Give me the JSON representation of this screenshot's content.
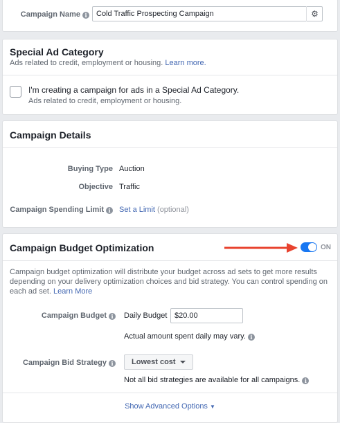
{
  "campaign_name": {
    "label": "Campaign Name",
    "value": "Cold Traffic Prospecting Campaign"
  },
  "special_ad_category": {
    "title": "Special Ad Category",
    "desc": "Ads related to credit, employment or housing.",
    "learn_more": "Learn more.",
    "checkbox_label": "I'm creating a campaign for ads in a Special Ad Category.",
    "checkbox_sub": "Ads related to credit, employment or housing."
  },
  "campaign_details": {
    "title": "Campaign Details",
    "buying_type_label": "Buying Type",
    "buying_type_value": "Auction",
    "objective_label": "Objective",
    "objective_value": "Traffic",
    "spending_limit_label": "Campaign Spending Limit",
    "set_limit_link": "Set a Limit",
    "optional": "(optional)"
  },
  "cbo": {
    "title": "Campaign Budget Optimization",
    "toggle_state": "ON",
    "desc": "Campaign budget optimization will distribute your budget across ad sets to get more results depending on your delivery optimization choices and bid strategy. You can control spending on each ad set.",
    "learn_more": "Learn More",
    "budget_label": "Campaign Budget",
    "budget_type": "Daily Budget",
    "budget_value": "$20.00",
    "budget_note": "Actual amount spent daily may vary.",
    "bid_strategy_label": "Campaign Bid Strategy",
    "bid_strategy_value": "Lowest cost",
    "bid_note": "Not all bid strategies are available for all campaigns.",
    "advanced_options": "Show Advanced Options"
  },
  "colors": {
    "accent": "#4267b2",
    "toggle": "#1877f2",
    "arrow": "#e8432f"
  }
}
